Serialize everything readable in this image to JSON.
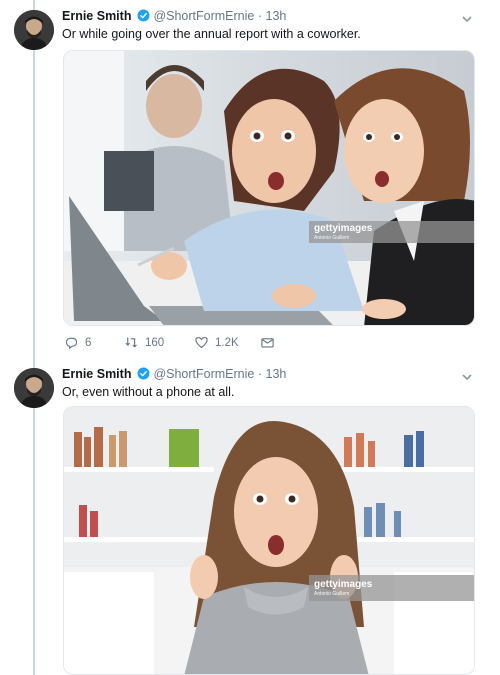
{
  "tweets": [
    {
      "author": {
        "name": "Ernie Smith",
        "handle": "@ShortFormErnie"
      },
      "dot": "·",
      "time": "13h",
      "text": "Or while going over the annual report with a coworker.",
      "image_alt": "Two women looking shocked at a laptop in an office",
      "watermark": {
        "brand": "gettyimages",
        "credit": "Antonio Guillem"
      },
      "stats": {
        "replies": "6",
        "retweets": "160",
        "likes": "1.2K"
      }
    },
    {
      "author": {
        "name": "Ernie Smith",
        "handle": "@ShortFormErnie"
      },
      "dot": "·",
      "time": "13h",
      "text": "Or, even without a phone at all.",
      "image_alt": "Woman with surprised expression in living room",
      "watermark": {
        "brand": "gettyimages",
        "credit": "Antonio Guillem"
      }
    }
  ],
  "colors": {
    "accent": "#1da1f2",
    "muted": "#657786",
    "thread": "#ccd6dd"
  },
  "icons": [
    "avatar",
    "verified-badge-icon",
    "chevron-down-icon",
    "reply-icon",
    "retweet-icon",
    "like-icon",
    "dm-icon"
  ]
}
